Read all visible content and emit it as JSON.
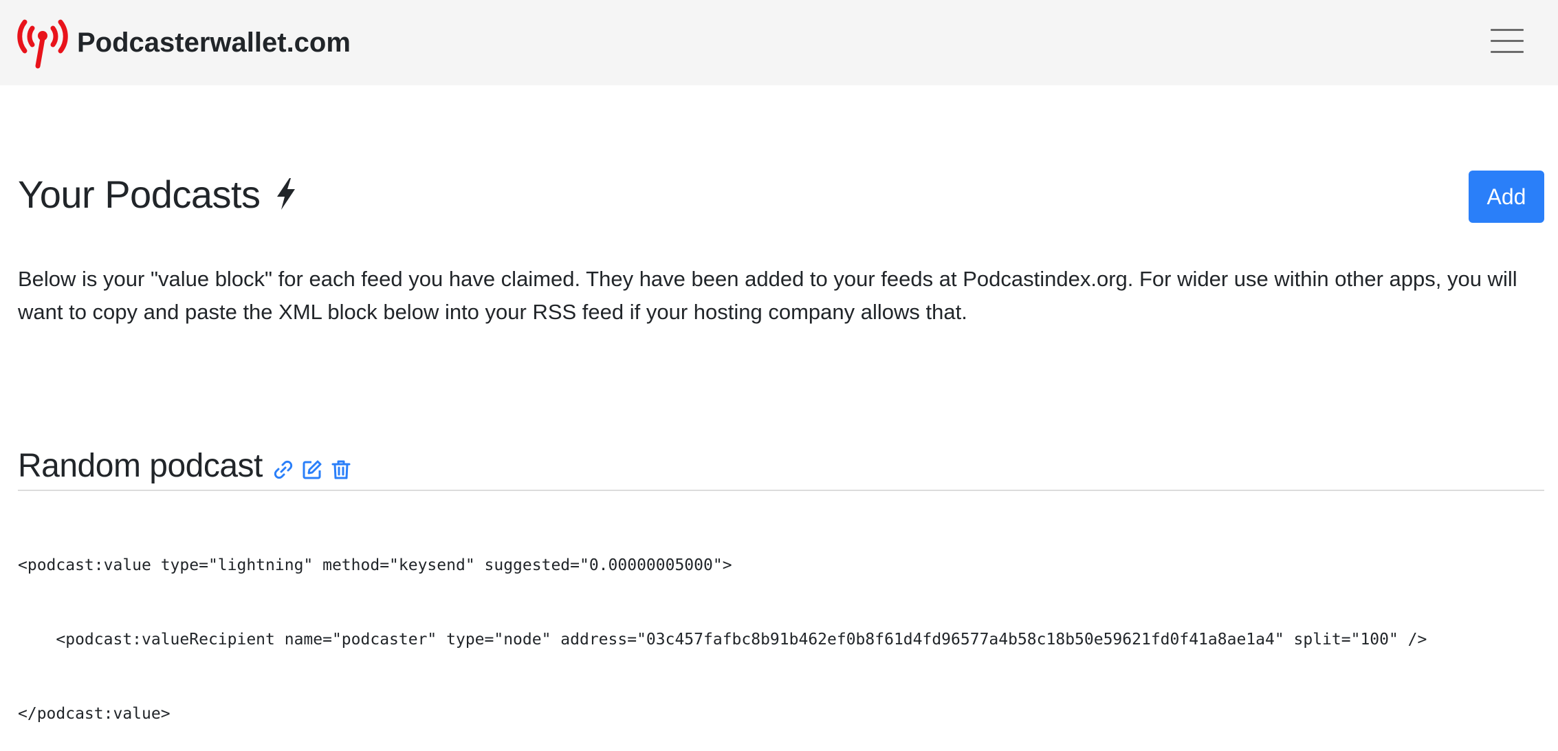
{
  "navbar": {
    "brand_text": "Podcasterwallet.com",
    "brand_icon": "broadcast-tower-icon",
    "menu_icon": "hamburger-menu-icon"
  },
  "main": {
    "title": "Your Podcasts",
    "title_icon": "lightning-bolt-icon",
    "add_label": "Add",
    "description": "Below is your \"value block\" for each feed you have claimed. They have been added to your feeds at Podcastindex.org. For wider use within other apps, you will want to copy and paste the XML block below into your RSS feed if your hosting company allows that."
  },
  "podcast": {
    "name": "Random podcast",
    "icons": [
      "link-icon",
      "edit-icon",
      "trash-icon"
    ],
    "xml_lines": [
      "<podcast:value type=\"lightning\" method=\"keysend\" suggested=\"0.00000005000\">",
      "    <podcast:valueRecipient name=\"podcaster\" type=\"node\" address=\"03c457fafbc8b91b462ef0b8f61d4fd96577a4b58c18b50e59621fd0f41a8ae1a4\" split=\"100\" />",
      "</podcast:value>"
    ]
  },
  "colors": {
    "brand_red": "#e8131b",
    "primary_blue": "#2a7ff9",
    "icon_blue": "#2a7ff9",
    "navbar_bg": "#f5f5f5",
    "text_dark": "#212529"
  }
}
